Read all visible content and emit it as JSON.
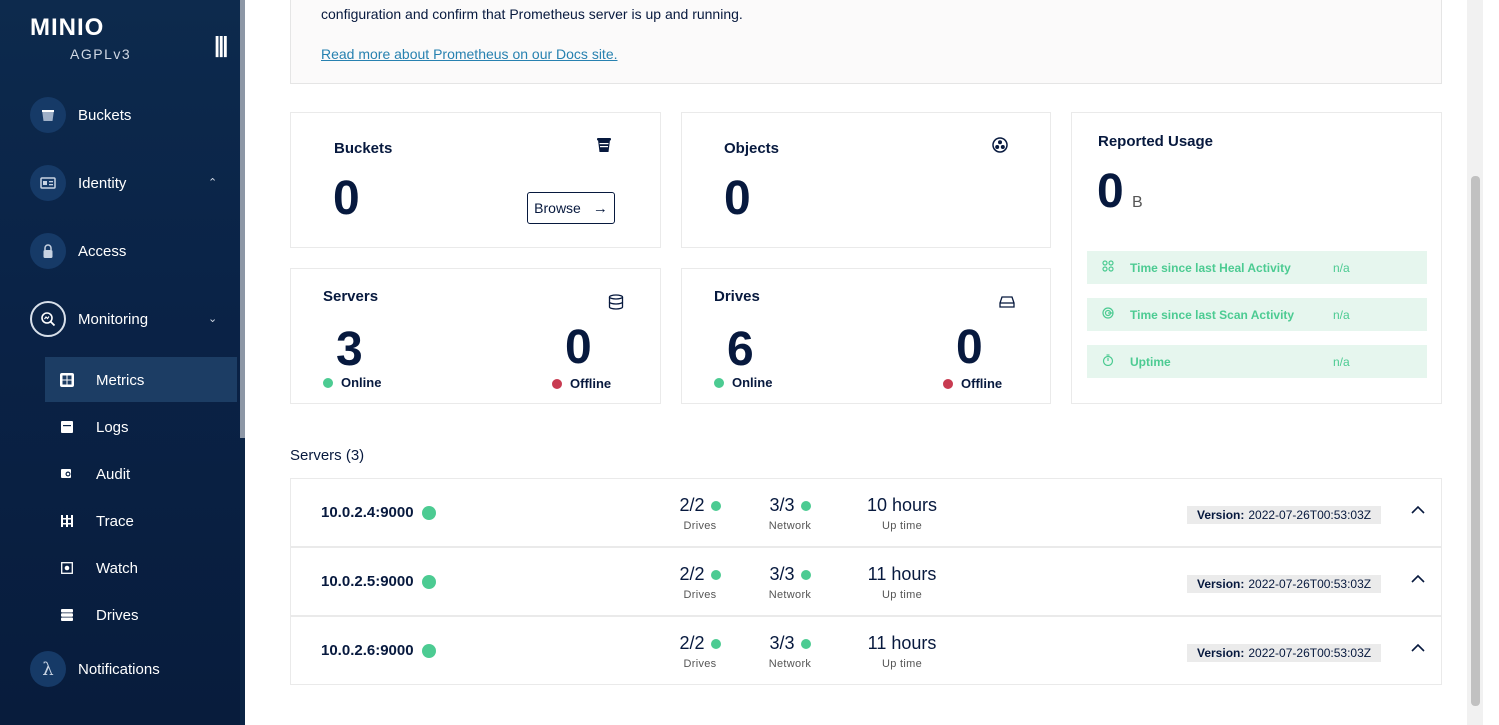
{
  "sidebar": {
    "logo": "MINIO",
    "license": "AGPLv3",
    "collapse_icon": "|||",
    "items": [
      {
        "label": "Buckets",
        "icon": "bucket-icon"
      },
      {
        "label": "Identity",
        "icon": "id-card-icon"
      },
      {
        "label": "Access",
        "icon": "lock-icon"
      },
      {
        "label": "Monitoring",
        "icon": "monitoring-icon"
      },
      {
        "label": "Notifications",
        "icon": "lambda-icon"
      }
    ],
    "sub_items": [
      {
        "label": "Metrics",
        "icon": "metrics-icon"
      },
      {
        "label": "Logs",
        "icon": "logs-icon"
      },
      {
        "label": "Audit",
        "icon": "audit-icon"
      },
      {
        "label": "Trace",
        "icon": "trace-icon"
      },
      {
        "label": "Watch",
        "icon": "watch-icon"
      },
      {
        "label": "Drives",
        "icon": "drives-icon"
      }
    ]
  },
  "prometheus": {
    "text": "configuration and confirm that Prometheus server is up and running.",
    "link": "Read more about Prometheus on our Docs site."
  },
  "cards": {
    "buckets": {
      "title": "Buckets",
      "value": "0",
      "browse": "Browse",
      "browse_arrow": "→"
    },
    "objects": {
      "title": "Objects",
      "value": "0"
    },
    "servers": {
      "title": "Servers",
      "online_value": "3",
      "online_label": "Online",
      "offline_value": "0",
      "offline_label": "Offline"
    },
    "drives": {
      "title": "Drives",
      "online_value": "6",
      "online_label": "Online",
      "offline_value": "0",
      "offline_label": "Offline"
    },
    "usage": {
      "title": "Reported Usage",
      "value": "0",
      "unit": "B",
      "rows": [
        {
          "label": "Time since last Heal Activity",
          "value": "n/a",
          "icon": "heal-icon"
        },
        {
          "label": "Time since last Scan Activity",
          "value": "n/a",
          "icon": "scan-icon"
        },
        {
          "label": "Uptime",
          "value": "n/a",
          "icon": "timer-icon"
        }
      ]
    }
  },
  "servers_list": {
    "heading": "Servers (3)",
    "version_label": "Version:",
    "drives_label": "Drives",
    "network_label": "Network",
    "uptime_label": "Up time",
    "rows": [
      {
        "name": "10.0.2.4:9000",
        "drives": "2/2",
        "network": "3/3",
        "uptime": "10 hours",
        "version": "2022-07-26T00:53:03Z"
      },
      {
        "name": "10.0.2.5:9000",
        "drives": "2/2",
        "network": "3/3",
        "uptime": "11 hours",
        "version": "2022-07-26T00:53:03Z"
      },
      {
        "name": "10.0.2.6:9000",
        "drives": "2/2",
        "network": "3/3",
        "uptime": "11 hours",
        "version": "2022-07-26T00:53:03Z"
      }
    ]
  },
  "colors": {
    "sidebar": "#0a2347",
    "online": "#4ccb92",
    "offline": "#c83b51",
    "link": "#2781b0"
  }
}
